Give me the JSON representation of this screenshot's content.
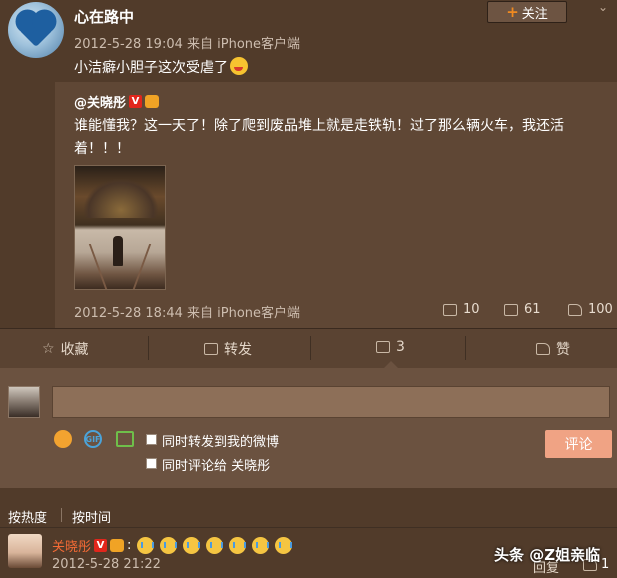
{
  "header": {
    "username": "心在路中",
    "follow_label": "关注",
    "meta": "2012-5-28 19:04 来自 iPhone客户端",
    "text": "小洁癖小胆子这次受虐了"
  },
  "repost": {
    "author": "@关晓彤",
    "vip_badge": "V",
    "text": "谁能懂我？这一天了！除了爬到废品堆上就是走铁轨！过了那么辆火车，我还活着！！！",
    "meta": "2012-5-28 18:44 来自 iPhone客户端",
    "reposts": "10",
    "comments": "61",
    "likes": "100"
  },
  "actions": {
    "favorite": "收藏",
    "forward": "转发",
    "comment_count": "3",
    "like": "赞"
  },
  "composer": {
    "option_forward": "同时转发到我的微博",
    "option_comment": "同时评论给 关晓彤",
    "submit_label": "评论"
  },
  "sort": {
    "hot": "按热度",
    "time": "按时间"
  },
  "comments": [
    {
      "author": "关晓彤",
      "vip_badge": "V",
      "time": "2012-5-28 21:22",
      "reply": "回复",
      "likes": "1"
    }
  ],
  "watermark": "头条 @Z姐亲临",
  "colors": {
    "background": "#513b2a",
    "repost_bg": "#5f4735",
    "accent_orange": "#f36a35",
    "submit_bg": "#f0a384"
  }
}
